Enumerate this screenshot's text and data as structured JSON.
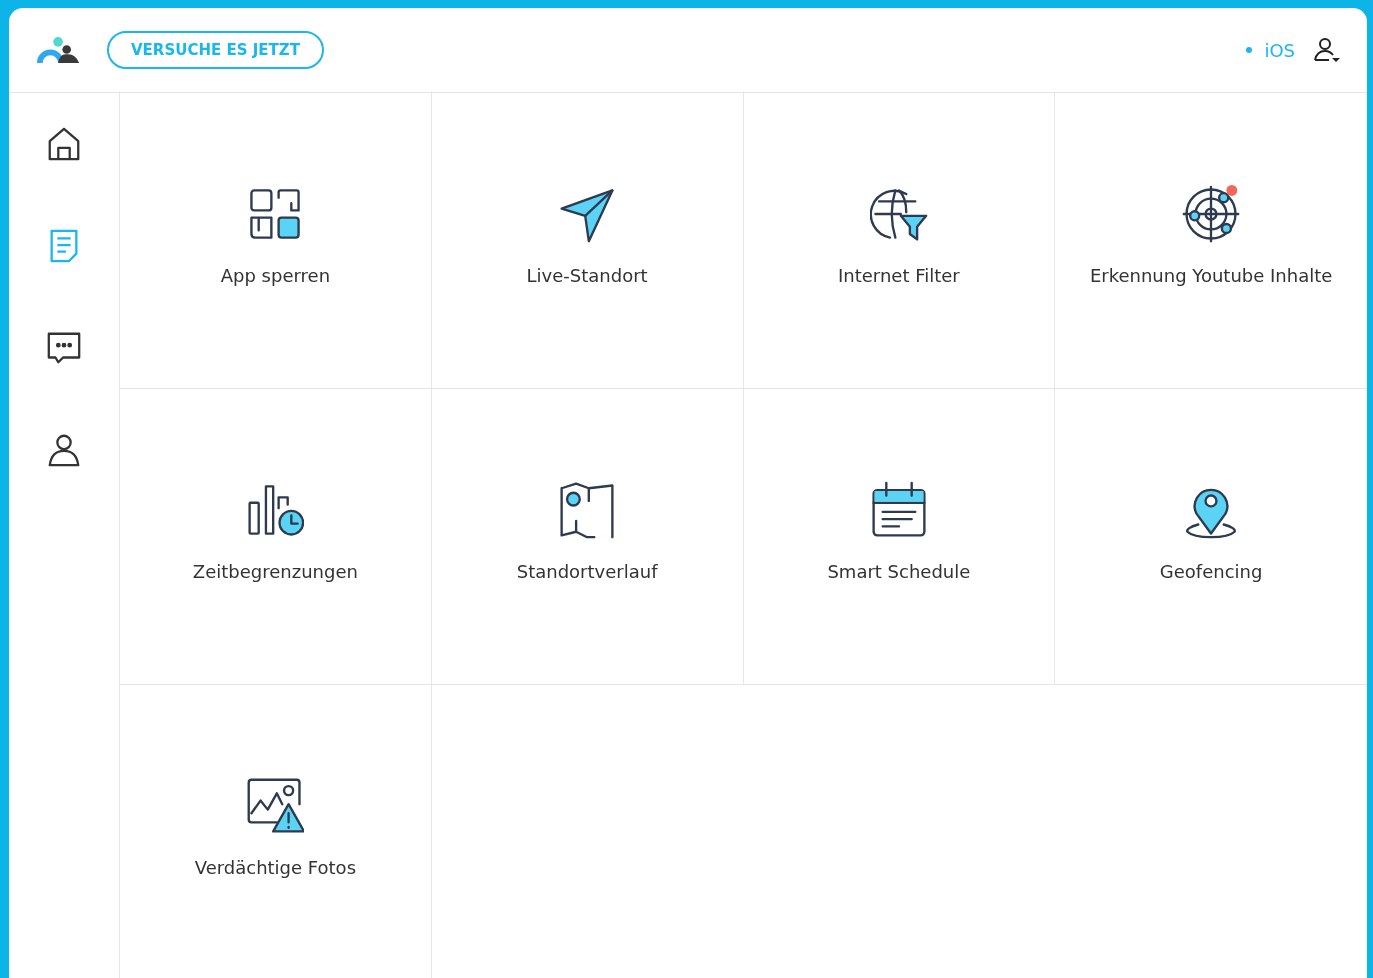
{
  "header": {
    "cta_button": "VERSUCHE ES JETZT",
    "platform": "iOS"
  },
  "sidebar": {
    "items": [
      {
        "selected": false
      },
      {
        "selected": true
      },
      {
        "selected": false
      },
      {
        "selected": false
      }
    ]
  },
  "tiles": [
    {
      "label": "App sperren"
    },
    {
      "label": "Live-Standort"
    },
    {
      "label": "Internet Filter"
    },
    {
      "label": "Erkennung Youtube Inhalte"
    },
    {
      "label": "Zeitbegrenzungen"
    },
    {
      "label": "Standortverlauf"
    },
    {
      "label": "Smart Schedule"
    },
    {
      "label": "Geofencing"
    },
    {
      "label": "Verdächtige Fotos"
    }
  ]
}
